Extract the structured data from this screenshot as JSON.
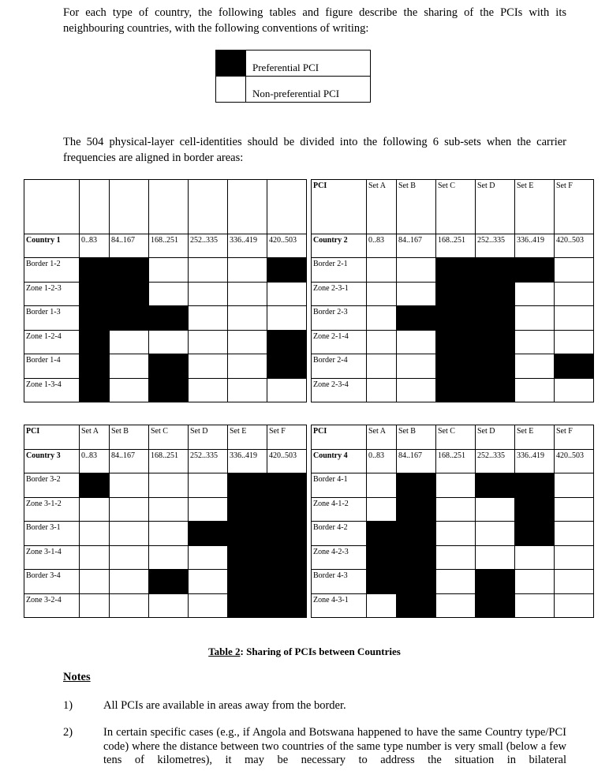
{
  "intro": {
    "line1": "For each type of country, the following tables and figure describe the sharing of the PCIs with its neighbouring countries, with the following conventions of writing:"
  },
  "legend": {
    "preferential": "Preferential PCI",
    "non_preferential": "Non-preferential PCI"
  },
  "subsets_text": "The 504 physical-layer cell-identities should be divided into the following 6 sub-sets when the carrier frequencies are aligned in border areas:",
  "set_header": {
    "pci": "PCI",
    "sets": [
      "Set A",
      "Set B",
      "Set C",
      "Set D",
      "Set E",
      "Set F"
    ],
    "ranges": [
      "0..83",
      "84..167",
      "168..251",
      "252..335",
      "336..419",
      "420..503"
    ]
  },
  "tables": [
    {
      "show_set_labels": false,
      "country": "Country 1",
      "rows": [
        {
          "label": "Border 1-2",
          "cells": [
            1,
            1,
            0,
            0,
            0,
            1
          ]
        },
        {
          "label": "Zone 1-2-3",
          "cells": [
            1,
            1,
            0,
            0,
            0,
            0
          ]
        },
        {
          "label": "Border 1-3",
          "cells": [
            1,
            1,
            1,
            0,
            0,
            0
          ]
        },
        {
          "label": "Zone 1-2-4",
          "cells": [
            1,
            0,
            0,
            0,
            0,
            1
          ]
        },
        {
          "label": "Border 1-4",
          "cells": [
            1,
            0,
            1,
            0,
            0,
            1
          ]
        },
        {
          "label": "Zone 1-3-4",
          "cells": [
            1,
            0,
            1,
            0,
            0,
            0
          ]
        }
      ]
    },
    {
      "show_set_labels": true,
      "country": "Country 2",
      "rows": [
        {
          "label": "Border 2-1",
          "cells": [
            0,
            0,
            1,
            1,
            1,
            0
          ]
        },
        {
          "label": "Zone 2-3-1",
          "cells": [
            0,
            0,
            1,
            1,
            0,
            0
          ]
        },
        {
          "label": "Border 2-3",
          "cells": [
            0,
            1,
            1,
            1,
            0,
            0
          ]
        },
        {
          "label": "Zone 2-1-4",
          "cells": [
            0,
            0,
            1,
            1,
            0,
            0
          ]
        },
        {
          "label": "Border 2-4",
          "cells": [
            0,
            0,
            1,
            1,
            0,
            1
          ]
        },
        {
          "label": "Zone 2-3-4",
          "cells": [
            0,
            0,
            1,
            1,
            0,
            0
          ]
        }
      ]
    },
    {
      "show_set_labels": true,
      "country": "Country 3",
      "rows": [
        {
          "label": "Border 3-2",
          "cells": [
            1,
            0,
            0,
            0,
            1,
            1
          ]
        },
        {
          "label": "Zone 3-1-2",
          "cells": [
            0,
            0,
            0,
            0,
            1,
            1
          ]
        },
        {
          "label": "Border 3-1",
          "cells": [
            0,
            0,
            0,
            1,
            1,
            1
          ]
        },
        {
          "label": "Zone 3-1-4",
          "cells": [
            0,
            0,
            0,
            0,
            1,
            1
          ]
        },
        {
          "label": "Border 3-4",
          "cells": [
            0,
            0,
            1,
            0,
            1,
            1
          ]
        },
        {
          "label": "Zone 3-2-4",
          "cells": [
            0,
            0,
            0,
            0,
            1,
            1
          ]
        }
      ]
    },
    {
      "show_set_labels": true,
      "country": "Country 4",
      "rows": [
        {
          "label": "Border 4-1",
          "cells": [
            0,
            1,
            0,
            1,
            1,
            0
          ]
        },
        {
          "label": "Zone 4-1-2",
          "cells": [
            0,
            1,
            0,
            0,
            1,
            0
          ]
        },
        {
          "label": "Border 4-2",
          "cells": [
            1,
            1,
            0,
            0,
            1,
            0
          ]
        },
        {
          "label": "Zone 4-2-3",
          "cells": [
            1,
            1,
            0,
            0,
            0,
            0
          ]
        },
        {
          "label": "Border 4-3",
          "cells": [
            1,
            1,
            0,
            1,
            0,
            0
          ]
        },
        {
          "label": "Zone 4-3-1",
          "cells": [
            0,
            1,
            0,
            1,
            0,
            0
          ]
        }
      ]
    }
  ],
  "caption": {
    "label": "Table 2",
    "text": ": Sharing of PCIs between Countries"
  },
  "notes": {
    "heading": "Notes",
    "items": [
      {
        "num": "1)",
        "text": "All PCIs are available in areas away from the border."
      },
      {
        "num": "2)",
        "text": "In certain specific cases (e.g., if Angola and Botswana happened to have the same Country type/PCI code) where the distance between two countries of the same type number is very small (below a few tens of kilometres), it may be necessary to address the situation in bilateral"
      }
    ]
  }
}
